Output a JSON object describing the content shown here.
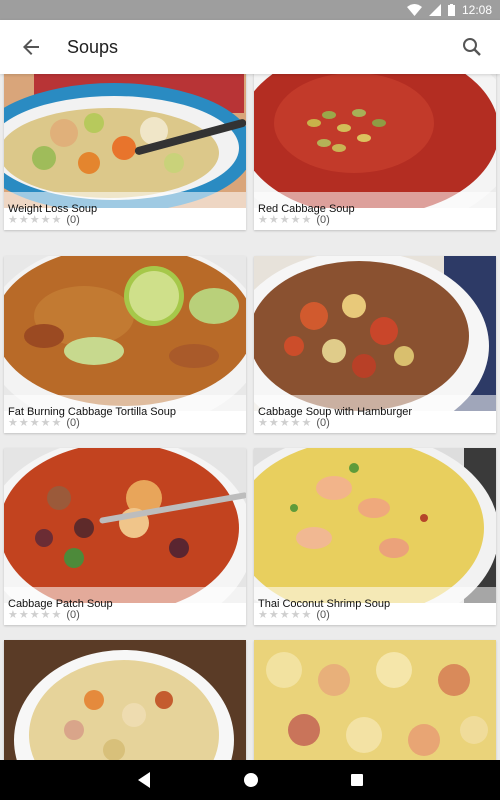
{
  "status": {
    "time": "12:08"
  },
  "app_bar": {
    "title": "Soups"
  },
  "recipes": [
    {
      "name": "Weight Loss Soup",
      "rating_count": "(0)"
    },
    {
      "name": "Red Cabbage Soup",
      "rating_count": "(0)"
    },
    {
      "name": "Fat Burning Cabbage Tortilla Soup",
      "rating_count": "(0)"
    },
    {
      "name": "Cabbage Soup with Hamburger",
      "rating_count": "(0)"
    },
    {
      "name": "Cabbage Patch Soup",
      "rating_count": "(0)"
    },
    {
      "name": "Thai Coconut Shrimp Soup",
      "rating_count": "(0)"
    }
  ],
  "stars": "★★★★★",
  "icons": {
    "back": "arrow-left-icon",
    "search": "search-icon",
    "nav_back": "triangle-back-icon",
    "nav_home": "circle-home-icon",
    "nav_recent": "square-recent-icon"
  }
}
